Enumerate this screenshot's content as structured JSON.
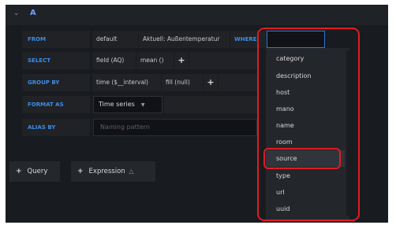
{
  "query": {
    "name": "A",
    "collapse_icon": "chevron-down-icon"
  },
  "rows": {
    "from": {
      "keyword": "FROM",
      "policy": "default",
      "measurement": "Aktuell: Außentemperatur",
      "where_keyword": "WHERE"
    },
    "select": {
      "keyword": "SELECT",
      "field": "field (AQ)",
      "func": "mean ()",
      "add": "+"
    },
    "group_by": {
      "keyword": "GROUP BY",
      "time": "time ($__interval)",
      "fill": "fill (null)",
      "add": "+"
    },
    "format_as": {
      "keyword": "FORMAT AS",
      "value": "Time series",
      "caret_icon": "caret-down-icon"
    },
    "alias_by": {
      "keyword": "ALIAS BY",
      "placeholder": "Naming pattern"
    }
  },
  "buttons": {
    "query": {
      "plus": "+",
      "label": "Query"
    },
    "expression": {
      "plus": "+",
      "label": "Expression",
      "icon": "warning-icon"
    }
  },
  "dropdown": {
    "items": [
      "category",
      "description",
      "host",
      "mano",
      "name",
      "room",
      "source",
      "type",
      "url",
      "uuid"
    ],
    "highlighted": "source"
  },
  "annotation_color": "#e11b22",
  "accent_color": "#3e8ce6"
}
